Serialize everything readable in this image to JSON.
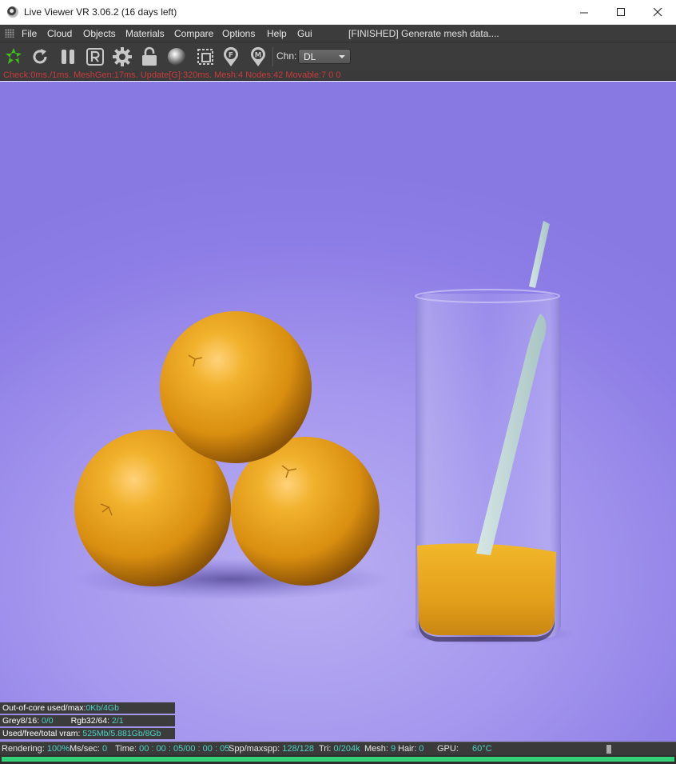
{
  "window": {
    "title": "Live Viewer VR 3.06.2 (16 days left)"
  },
  "menu": {
    "items": [
      "File",
      "Cloud",
      "Objects",
      "Materials",
      "Compare",
      "Options",
      "Help",
      "Gui"
    ],
    "status": "[FINISHED] Generate mesh data...."
  },
  "toolbar": {
    "icons": [
      "octane-logo-icon",
      "refresh-icon",
      "pause-icon",
      "region-render-icon",
      "settings-gear-icon",
      "lock-icon",
      "material-sphere-icon",
      "picker-icon",
      "focus-pin-icon",
      "material-pin-icon"
    ],
    "channel_label": "Chn:",
    "channel_value": "DL"
  },
  "stats_line": "Check:0ms./1ms. MeshGen:17ms. Update[G]:320ms. Mesh:4 Nodes:42 Movable:7  0 0",
  "memory": {
    "out_of_core_label": "Out-of-core used/max:",
    "out_of_core_value": "0Kb/4Gb",
    "grey_label": "Grey8/16:",
    "grey_value": "0/0",
    "rgb_label": "Rgb32/64:",
    "rgb_value": "2/1",
    "vram_label": "Used/free/total vram:",
    "vram_value": "525Mb/5.881Gb/8Gb"
  },
  "statusbar": {
    "rendering_label": "Rendering:",
    "rendering_value": "100%",
    "ms_label": "Ms/sec:",
    "ms_value": "0",
    "time_label": "Time:",
    "time_value": "00 : 00 : 05/00 : 00 : 05",
    "spp_label": "Spp/maxspp:",
    "spp_value": "128/128",
    "tri_label": "Tri:",
    "tri_value": "0/204k",
    "mesh_label": "Mesh:",
    "mesh_value": "9",
    "hair_label": "Hair:",
    "hair_value": "0",
    "gpu_label": "GPU:",
    "gpu_value": "60°C",
    "progress": 1.0
  },
  "colors": {
    "background": "#a597ee",
    "orange": "#e7a21c",
    "juice": "#e9a91e",
    "accent_value": "#4fd1c5",
    "stats_text": "#c83c3c",
    "progress": "#34d179"
  }
}
